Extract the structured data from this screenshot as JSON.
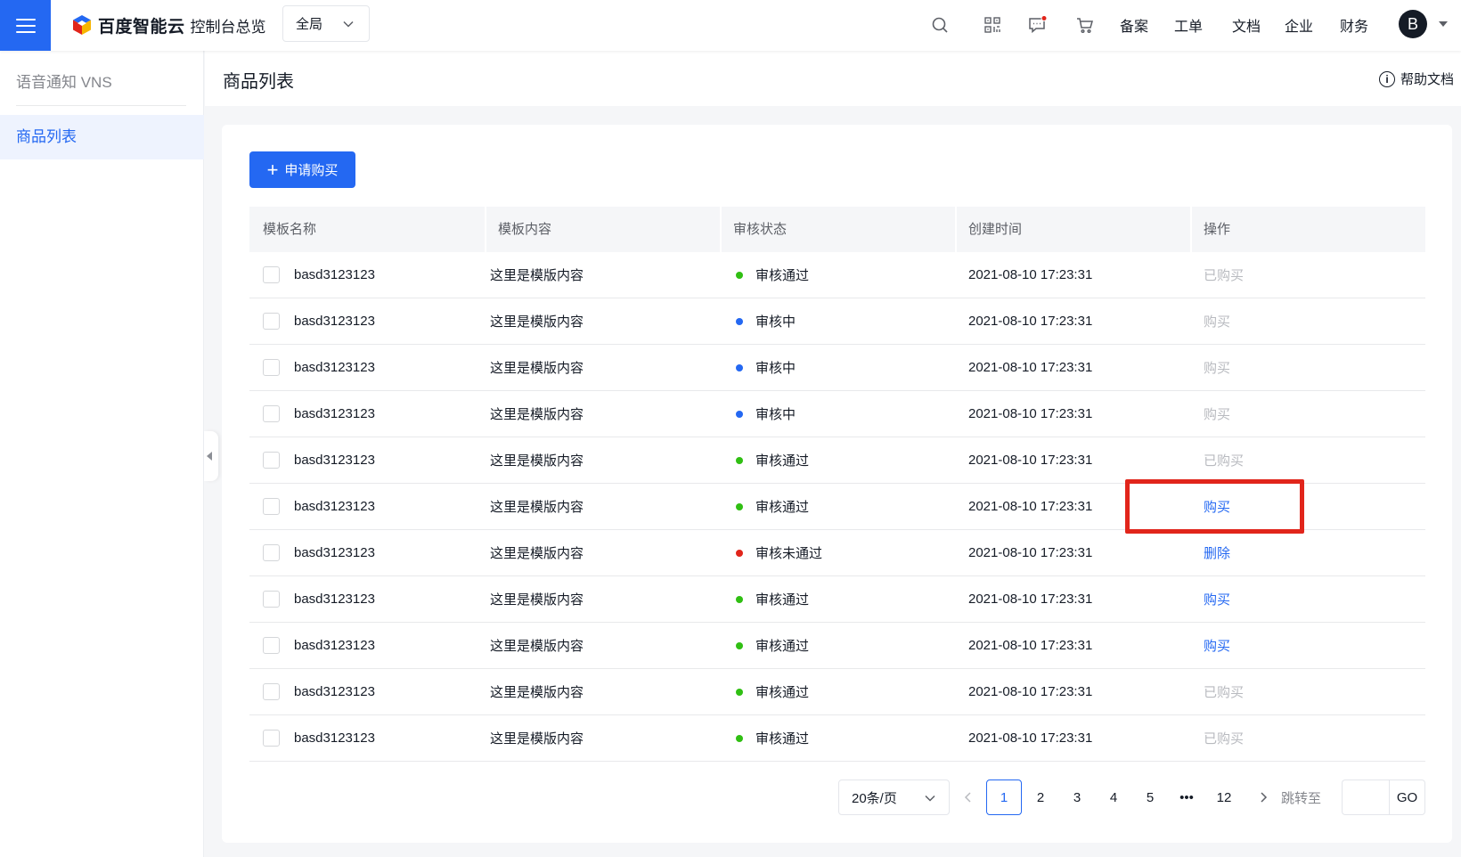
{
  "topbar": {
    "brand": "百度智能云",
    "console": "控制台总览",
    "region": "全局",
    "nav": [
      "备案",
      "工单",
      "文档",
      "企业",
      "财务"
    ],
    "avatar_letter": "B",
    "icons": [
      "search-icon",
      "qrcode-icon",
      "message-icon",
      "cart-icon"
    ],
    "accent_color": "#2468f2",
    "notify_color": "#e1251b"
  },
  "sidebar": {
    "title": "语音通知 VNS",
    "items": [
      {
        "label": "商品列表",
        "active": true
      }
    ]
  },
  "page": {
    "title": "商品列表",
    "help": "帮助文档",
    "apply_button": "申请购买"
  },
  "table": {
    "columns": [
      "模板名称",
      "模板内容",
      "审核状态",
      "创建时间",
      "操作"
    ],
    "rows": [
      {
        "name": "basd3123123",
        "content": "这里是模版内容",
        "status": "审核通过",
        "status_color": "#30bf13",
        "time": "2021-08-10 17:23:31",
        "op": "已购买",
        "op_state": "disabled"
      },
      {
        "name": "basd3123123",
        "content": "这里是模版内容",
        "status": "审核中",
        "status_color": "#2468f2",
        "time": "2021-08-10 17:23:31",
        "op": "购买",
        "op_state": "disabled"
      },
      {
        "name": "basd3123123",
        "content": "这里是模版内容",
        "status": "审核中",
        "status_color": "#2468f2",
        "time": "2021-08-10 17:23:31",
        "op": "购买",
        "op_state": "disabled"
      },
      {
        "name": "basd3123123",
        "content": "这里是模版内容",
        "status": "审核中",
        "status_color": "#2468f2",
        "time": "2021-08-10 17:23:31",
        "op": "购买",
        "op_state": "disabled"
      },
      {
        "name": "basd3123123",
        "content": "这里是模版内容",
        "status": "审核通过",
        "status_color": "#30bf13",
        "time": "2021-08-10 17:23:31",
        "op": "已购买",
        "op_state": "disabled"
      },
      {
        "name": "basd3123123",
        "content": "这里是模版内容",
        "status": "审核通过",
        "status_color": "#30bf13",
        "time": "2021-08-10 17:23:31",
        "op": "购买",
        "op_state": "active"
      },
      {
        "name": "basd3123123",
        "content": "这里是模版内容",
        "status": "审核未通过",
        "status_color": "#e1251b",
        "time": "2021-08-10 17:23:31",
        "op": "删除",
        "op_state": "active"
      },
      {
        "name": "basd3123123",
        "content": "这里是模版内容",
        "status": "审核通过",
        "status_color": "#30bf13",
        "time": "2021-08-10 17:23:31",
        "op": "购买",
        "op_state": "active"
      },
      {
        "name": "basd3123123",
        "content": "这里是模版内容",
        "status": "审核通过",
        "status_color": "#30bf13",
        "time": "2021-08-10 17:23:31",
        "op": "购买",
        "op_state": "active"
      },
      {
        "name": "basd3123123",
        "content": "这里是模版内容",
        "status": "审核通过",
        "status_color": "#30bf13",
        "time": "2021-08-10 17:23:31",
        "op": "已购买",
        "op_state": "disabled"
      },
      {
        "name": "basd3123123",
        "content": "这里是模版内容",
        "status": "审核通过",
        "status_color": "#30bf13",
        "time": "2021-08-10 17:23:31",
        "op": "已购买",
        "op_state": "disabled"
      }
    ],
    "link_color": "#2468f2",
    "disabled_color": "#b8babf"
  },
  "pagination": {
    "page_size": "20条/页",
    "pages": [
      "1",
      "2",
      "3",
      "4",
      "5",
      "•••",
      "12"
    ],
    "current": "1",
    "jump_label": "跳转至",
    "go": "GO"
  }
}
